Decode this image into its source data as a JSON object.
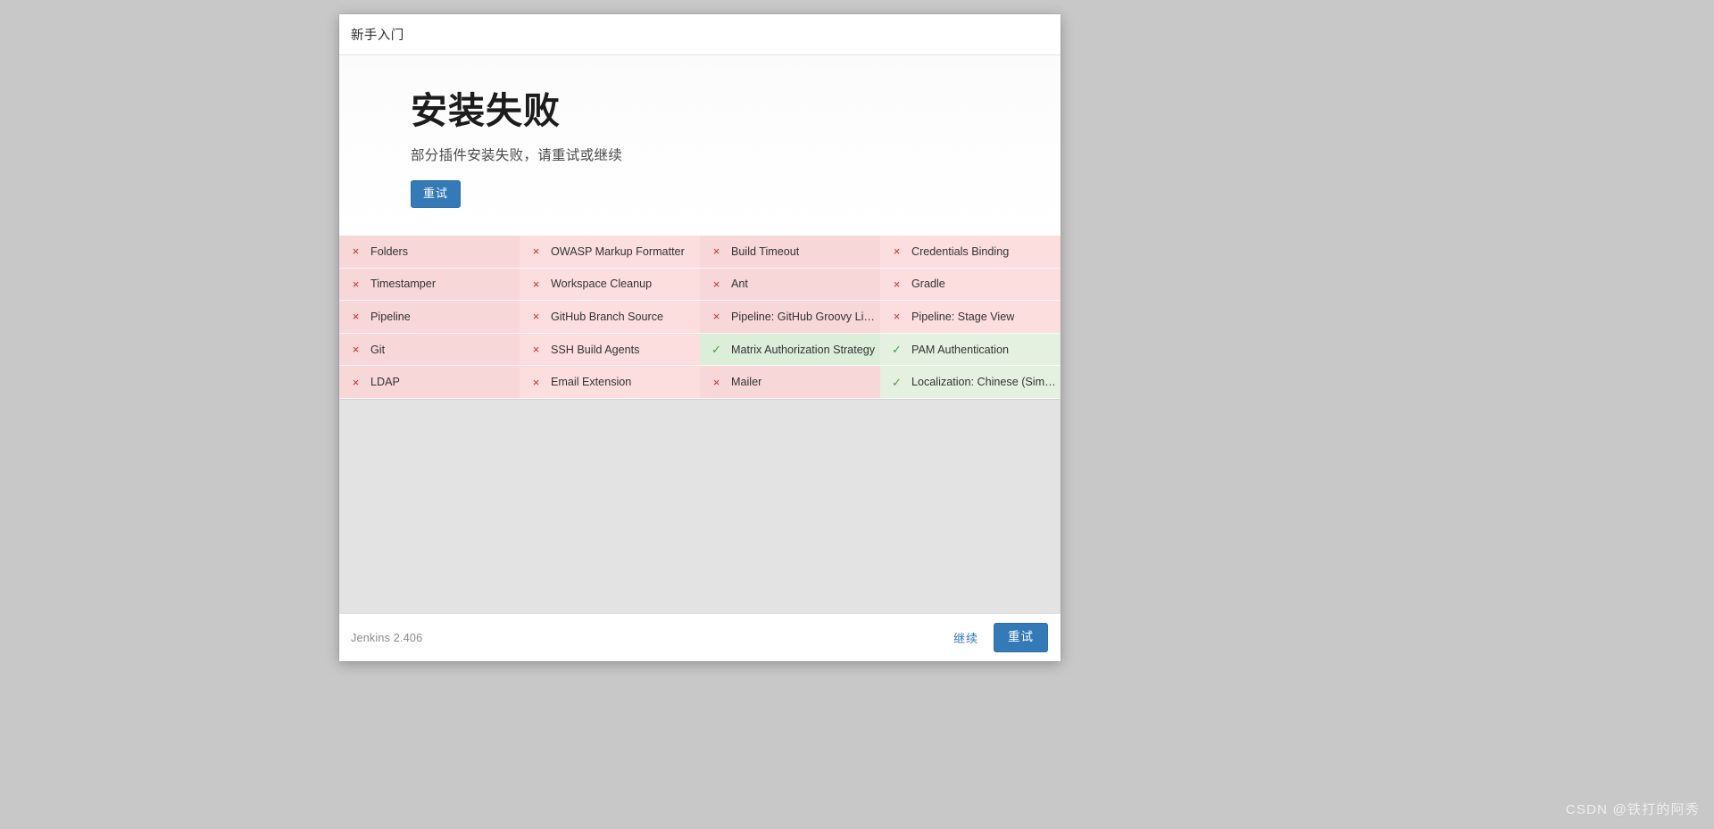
{
  "window": {
    "background_color": "#c8c8c8",
    "header_title": "新手入门"
  },
  "hero": {
    "title": "安装失败",
    "subtitle": "部分插件安装失败，请重试或继续",
    "retry_label": "重试"
  },
  "icons": {
    "fail": "×",
    "ok": "✓"
  },
  "colors": {
    "primary": "#337ab7",
    "fail_bg": "#f7d7d7",
    "fail_bg_alt": "#fbdedd",
    "ok_bg": "#dcedda",
    "ok_bg_alt": "#e4f1e1",
    "fail_icon": "#c9302c",
    "ok_icon": "#4b9a4b"
  },
  "plugins": {
    "columns": 4,
    "rows": 5,
    "cells": [
      {
        "name": "Folders",
        "status": "fail",
        "icon": "×"
      },
      {
        "name": "OWASP Markup Formatter",
        "status": "fail",
        "icon": "×"
      },
      {
        "name": "Build Timeout",
        "status": "fail",
        "icon": "×"
      },
      {
        "name": "Credentials Binding",
        "status": "fail",
        "icon": "×"
      },
      {
        "name": "Timestamper",
        "status": "fail",
        "icon": "×"
      },
      {
        "name": "Workspace Cleanup",
        "status": "fail",
        "icon": "×"
      },
      {
        "name": "Ant",
        "status": "fail",
        "icon": "×"
      },
      {
        "name": "Gradle",
        "status": "fail",
        "icon": "×"
      },
      {
        "name": "Pipeline",
        "status": "fail",
        "icon": "×"
      },
      {
        "name": "GitHub Branch Source",
        "status": "fail",
        "icon": "×"
      },
      {
        "name": "Pipeline: GitHub Groovy Libraries",
        "status": "fail",
        "icon": "×"
      },
      {
        "name": "Pipeline: Stage View",
        "status": "fail",
        "icon": "×"
      },
      {
        "name": "Git",
        "status": "fail",
        "icon": "×"
      },
      {
        "name": "SSH Build Agents",
        "status": "fail",
        "icon": "×"
      },
      {
        "name": "Matrix Authorization Strategy",
        "status": "ok",
        "icon": "✓"
      },
      {
        "name": "PAM Authentication",
        "status": "ok",
        "icon": "✓"
      },
      {
        "name": "LDAP",
        "status": "fail",
        "icon": "×"
      },
      {
        "name": "Email Extension",
        "status": "fail",
        "icon": "×"
      },
      {
        "name": "Mailer",
        "status": "fail",
        "icon": "×"
      },
      {
        "name": "Localization: Chinese (Simplified)",
        "status": "ok",
        "icon": "✓"
      }
    ]
  },
  "footer": {
    "version": "Jenkins 2.406",
    "continue_label": "继续",
    "retry_label": "重试"
  },
  "watermark": {
    "text": "CSDN @铁打的阿秀"
  }
}
